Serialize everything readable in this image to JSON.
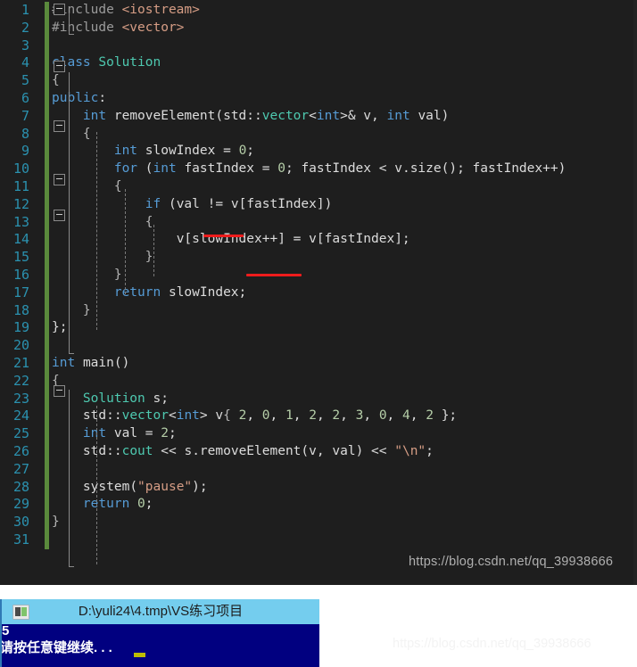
{
  "editor": {
    "theme": "visual-studio-dark",
    "background": "#1e1e1e",
    "line_number_color": "#2b91af",
    "change_bar_color": "#5a8a3c",
    "first_visible_line": 1,
    "last_visible_line": 31,
    "lines": [
      {
        "n": "1",
        "text": "#include <iostream>"
      },
      {
        "n": "2",
        "text": "#include <vector>"
      },
      {
        "n": "3",
        "text": ""
      },
      {
        "n": "4",
        "text": "class Solution"
      },
      {
        "n": "5",
        "text": "{"
      },
      {
        "n": "6",
        "text": "public:"
      },
      {
        "n": "7",
        "text": "    int removeElement(std::vector<int>& v, int val)"
      },
      {
        "n": "8",
        "text": "    {"
      },
      {
        "n": "9",
        "text": "        int slowIndex = 0;"
      },
      {
        "n": "10",
        "text": "        for (int fastIndex = 0; fastIndex < v.size(); fastIndex++)"
      },
      {
        "n": "11",
        "text": "        {"
      },
      {
        "n": "12",
        "text": "            if (val != v[fastIndex])"
      },
      {
        "n": "13",
        "text": "            {"
      },
      {
        "n": "14",
        "text": "                v[slowIndex++] = v[fastIndex];"
      },
      {
        "n": "15",
        "text": "            }"
      },
      {
        "n": "16",
        "text": "        }"
      },
      {
        "n": "17",
        "text": "        return slowIndex;"
      },
      {
        "n": "18",
        "text": "    }"
      },
      {
        "n": "19",
        "text": "};"
      },
      {
        "n": "20",
        "text": ""
      },
      {
        "n": "21",
        "text": "int main()"
      },
      {
        "n": "22",
        "text": "{"
      },
      {
        "n": "23",
        "text": "    Solution s;"
      },
      {
        "n": "24",
        "text": "    std::vector<int> v{ 2, 0, 1, 2, 2, 3, 0, 4, 2 };"
      },
      {
        "n": "25",
        "text": "    int val = 2;"
      },
      {
        "n": "26",
        "text": "    std::cout << s.removeElement(v, val) << \"\\n\";"
      },
      {
        "n": "27",
        "text": ""
      },
      {
        "n": "28",
        "text": "    system(\"pause\");"
      },
      {
        "n": "29",
        "text": "    return 0;"
      },
      {
        "n": "30",
        "text": "}"
      },
      {
        "n": "31",
        "text": ""
      }
    ],
    "annotations": {
      "underline_color": "#ee1c1c",
      "items": [
        {
          "label": "underline-val-notequal",
          "targets_line": "12"
        },
        {
          "label": "underline-slowindex-increment",
          "targets_line": "14"
        }
      ]
    },
    "watermark": "https://blog.csdn.net/qq_39938666"
  },
  "page_watermark": "https://blog.csdn.net/qq_39938666",
  "console": {
    "title": "D:\\yuli24\\4.tmp\\VS练习项目",
    "title_bar_color": "#74cdee",
    "body_color": "#010080",
    "output": "5",
    "prompt": "请按任意键继续. . .",
    "cursor": "block"
  }
}
